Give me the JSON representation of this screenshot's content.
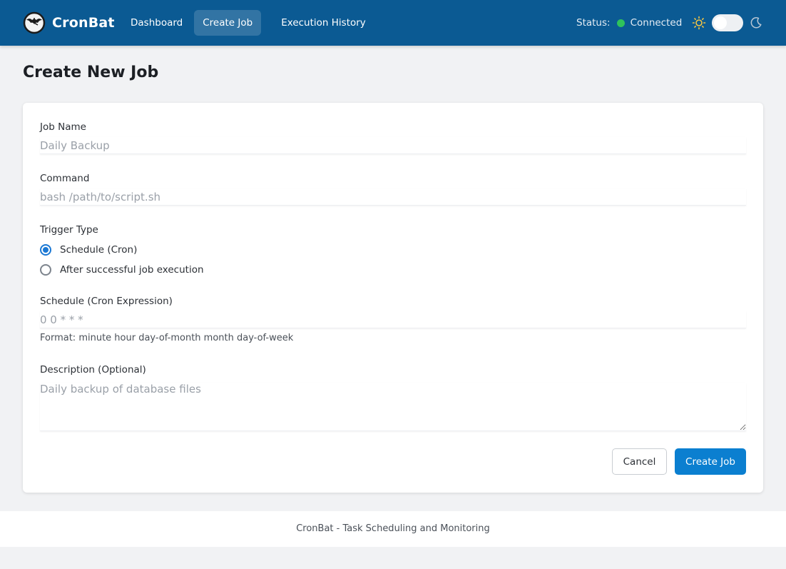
{
  "header": {
    "brand": "CronBat",
    "nav": [
      {
        "label": "Dashboard",
        "active": false
      },
      {
        "label": "Create Job",
        "active": true
      },
      {
        "label": "Execution History",
        "active": false
      }
    ],
    "status_label": "Status:",
    "status_value": "Connected",
    "status_color": "#2fc25b",
    "theme_toggle_on": false
  },
  "page": {
    "title": "Create New Job"
  },
  "form": {
    "job_name": {
      "label": "Job Name",
      "value": "",
      "placeholder": "Daily Backup"
    },
    "command": {
      "label": "Command",
      "value": "",
      "placeholder": "bash /path/to/script.sh"
    },
    "trigger_type": {
      "label": "Trigger Type",
      "options": [
        {
          "label": "Schedule (Cron)",
          "checked": true
        },
        {
          "label": "After successful job execution",
          "checked": false
        }
      ]
    },
    "schedule": {
      "label": "Schedule (Cron Expression)",
      "value": "",
      "placeholder": "0 0 * * *",
      "hint": "Format: minute hour day-of-month month day-of-week"
    },
    "description": {
      "label": "Description (Optional)",
      "value": "",
      "placeholder": "Daily backup of database files"
    },
    "cancel_label": "Cancel",
    "submit_label": "Create Job"
  },
  "footer": {
    "text": "CronBat - Task Scheduling and Monitoring"
  },
  "colors": {
    "header_bg": "#0b5a93",
    "primary_button": "#0b7fd0",
    "radio_accent": "#1b78d4"
  }
}
